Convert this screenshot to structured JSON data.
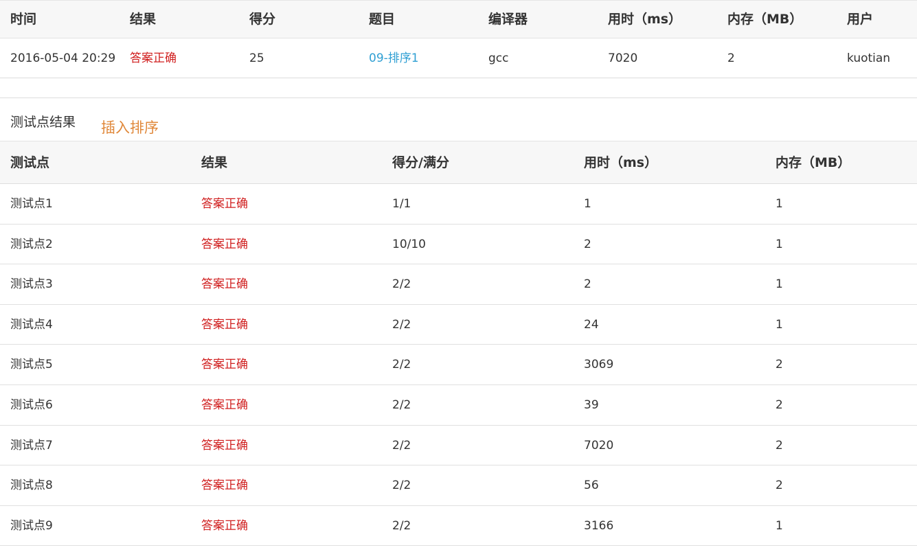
{
  "submission": {
    "headers": [
      "时间",
      "结果",
      "得分",
      "题目",
      "编译器",
      "用时（ms）",
      "内存（MB）",
      "用户"
    ],
    "time": "2016-05-04 20:29",
    "result": "答案正确",
    "score": "25",
    "problem": "09-排序1",
    "compiler": "gcc",
    "time_ms": "7020",
    "memory_mb": "2",
    "user": "kuotian"
  },
  "section": {
    "title": "测试点结果",
    "tag": "插入排序"
  },
  "cases": {
    "headers": [
      "测试点",
      "结果",
      "得分/满分",
      "用时（ms）",
      "内存（MB）"
    ],
    "rows": [
      [
        "测试点1",
        "答案正确",
        "1/1",
        "1",
        "1"
      ],
      [
        "测试点2",
        "答案正确",
        "10/10",
        "2",
        "1"
      ],
      [
        "测试点3",
        "答案正确",
        "2/2",
        "2",
        "1"
      ],
      [
        "测试点4",
        "答案正确",
        "2/2",
        "24",
        "1"
      ],
      [
        "测试点5",
        "答案正确",
        "2/2",
        "3069",
        "2"
      ],
      [
        "测试点6",
        "答案正确",
        "2/2",
        "39",
        "2"
      ],
      [
        "测试点7",
        "答案正确",
        "2/2",
        "7020",
        "2"
      ],
      [
        "测试点8",
        "答案正确",
        "2/2",
        "56",
        "2"
      ],
      [
        "测试点9",
        "答案正确",
        "2/2",
        "3166",
        "1"
      ]
    ]
  },
  "colors": {
    "accepted": "#d01e1e",
    "link": "#2f9fd3",
    "tag": "#e0883a",
    "header_bg": "#f7f7f7"
  }
}
